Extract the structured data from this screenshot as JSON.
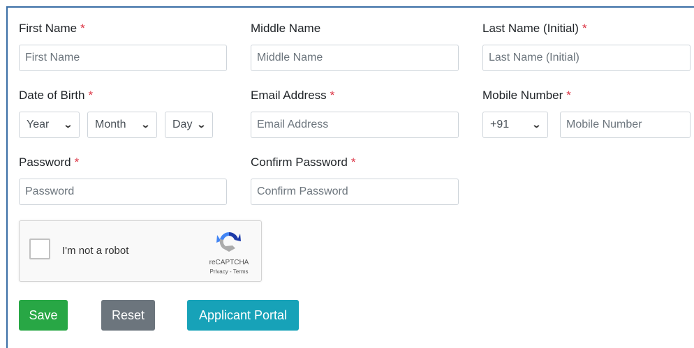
{
  "form": {
    "first_name": {
      "label": "First Name",
      "required_mark": "*",
      "placeholder": "First Name"
    },
    "middle_name": {
      "label": "Middle Name",
      "placeholder": "Middle Name"
    },
    "last_name": {
      "label": "Last Name (Initial)",
      "required_mark": "*",
      "placeholder": "Last Name (Initial)"
    },
    "dob": {
      "label": "Date of Birth",
      "required_mark": "*",
      "year": "Year",
      "month": "Month",
      "day": "Day"
    },
    "email": {
      "label": "Email Address",
      "required_mark": "*",
      "placeholder": "Email Address"
    },
    "mobile": {
      "label": "Mobile Number",
      "required_mark": "*",
      "country_code": "+91",
      "placeholder": "Mobile Number"
    },
    "password": {
      "label": "Password",
      "required_mark": "*",
      "placeholder": "Password"
    },
    "confirm_password": {
      "label": "Confirm Password",
      "required_mark": "*",
      "placeholder": "Confirm Password"
    }
  },
  "captcha": {
    "text": "I'm not a robot",
    "brand": "reCAPTCHA",
    "links": "Privacy - Terms",
    "icon": "recaptcha-icon"
  },
  "buttons": {
    "save": {
      "label": "Save",
      "color": "#28a745"
    },
    "reset": {
      "label": "Reset",
      "color": "#6c757d"
    },
    "portal": {
      "label": "Applicant Portal",
      "color": "#17a2b8"
    }
  }
}
